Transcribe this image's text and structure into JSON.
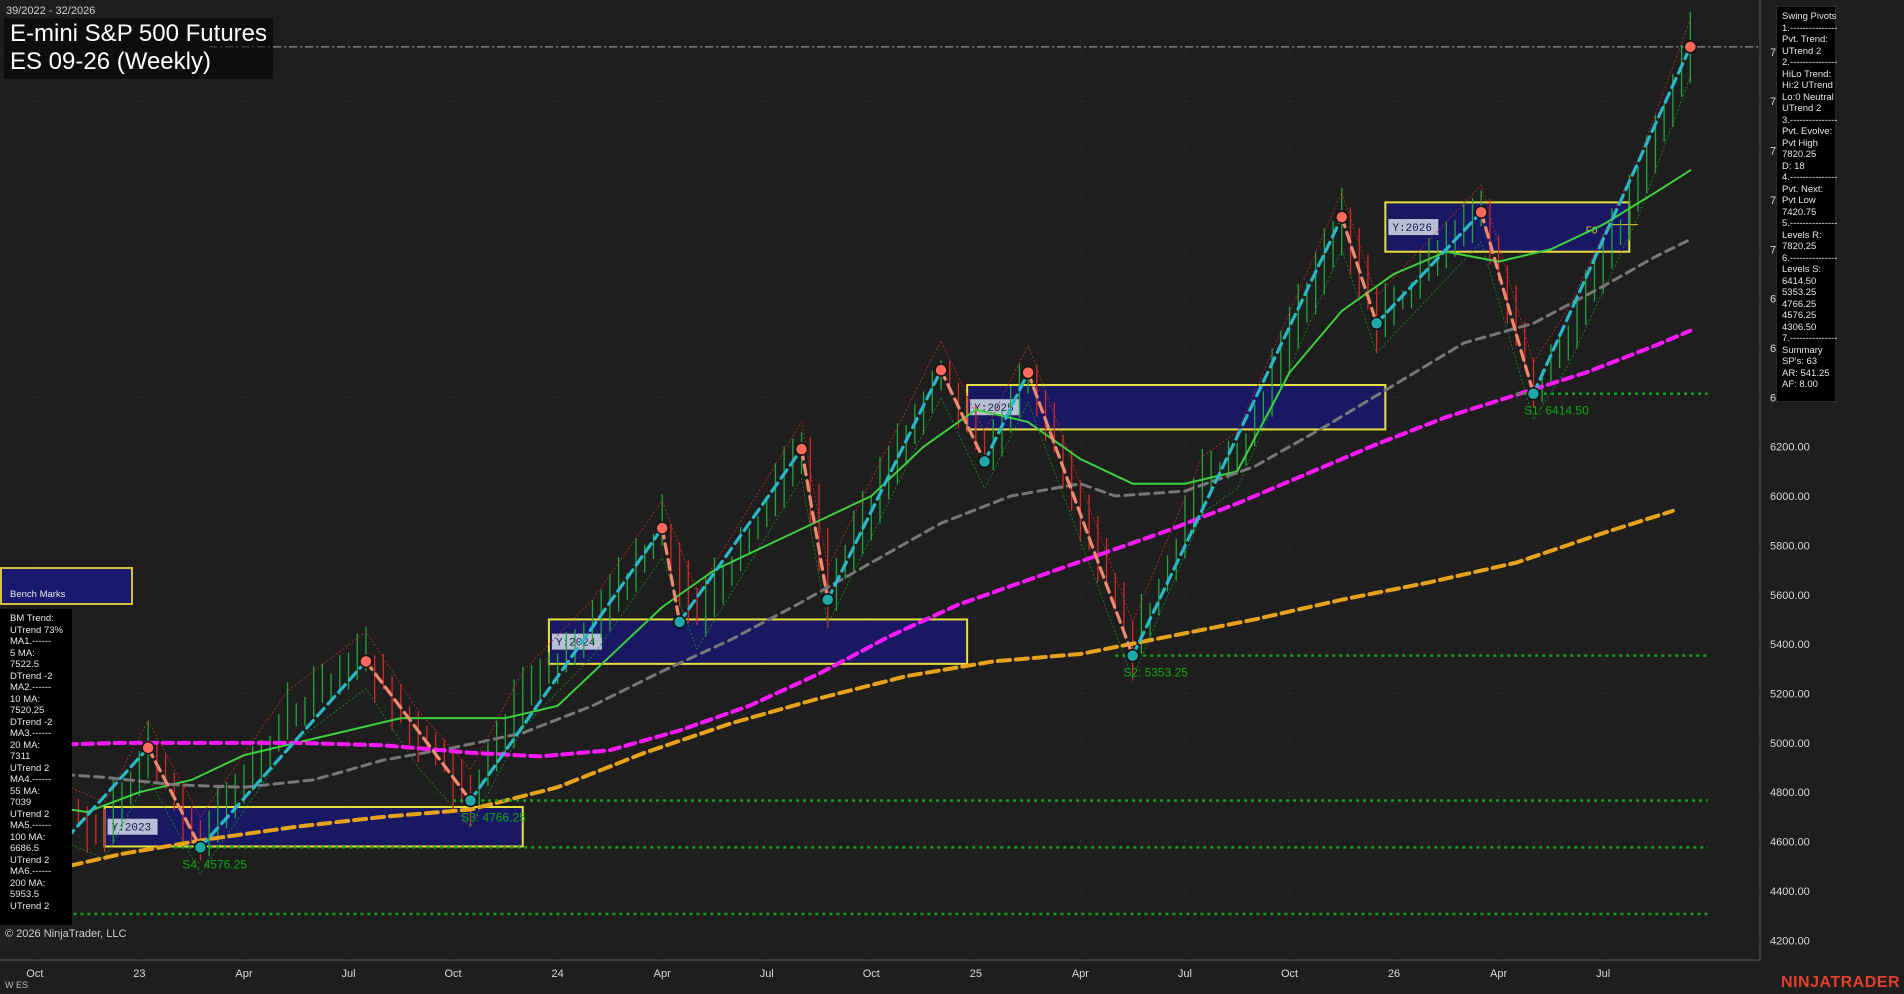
{
  "header": {
    "date_range": "39/2022 - 32/2026",
    "title_line1": "E-mini S&P 500 Futures",
    "title_line2": "ES 09-26 (Weekly)"
  },
  "footer": {
    "copyright": "© 2026 NinjaTrader, LLC",
    "symbol": "W ES",
    "brand": "NINJATRADER"
  },
  "colors": {
    "background": "#1e1e1e",
    "grid": "#3a3a3a",
    "bar_up": "#22a83a",
    "bar_down": "#d42a2a",
    "ma_green": "#3ecf3e",
    "ma_gray": "#777777",
    "ma_magenta": "#ff1aff",
    "ma_orange": "#e6a21a",
    "swing_up": "#2ab8c8",
    "swing_down": "#f08a6e",
    "year_box_fill": "#191970",
    "year_box_border": "#e8e03a",
    "support_line": "#11a611",
    "brand": "#e4402b"
  },
  "swing_pivots_panel": {
    "lines": [
      "Swing Pivots",
      "1.---------------",
      "Pvt. Trend:",
      "UTrend 2",
      "2.---------------",
      "HiLo Trend:",
      "Hi:2 UTrend",
      "Lo:0 Neutral",
      "UTrend 2",
      "3.---------------",
      "Pvt. Evolve:",
      "Pvt High",
      "7820.25",
      "D: 18",
      "4.---------------",
      "Pvt. Next:",
      "Pvt Low",
      "7420.75",
      "5.---------------",
      "Levels R:",
      "7820.25",
      "6.---------------",
      "Levels S:",
      "6414.50",
      "5353.25",
      "4766.25",
      "4576.25",
      "4306.50",
      "7.---------------",
      "Summary",
      "SP's: 63",
      "AR: 541.25",
      "AF: 8.00"
    ]
  },
  "bench_marks_panel": {
    "header": "Bench Marks",
    "lines": [
      "BM Trend:",
      "UTrend 73%",
      "MA1.------",
      "5 MA:",
      "7522.5",
      "DTrend -2",
      "MA2.------",
      "10 MA:",
      "7520.25",
      "DTrend -2",
      "MA3.------",
      "20 MA:",
      "7311",
      "UTrend 2",
      "MA4.------",
      "55 MA:",
      "7039",
      "UTrend 2",
      "MA5.------",
      "100 MA:",
      "6686.5",
      "UTrend 2",
      "MA6.------",
      "200 MA:",
      "5953.5",
      "UTrend 2"
    ]
  },
  "chart_data": {
    "type": "candlestick",
    "y_range": [
      4120,
      8010
    ],
    "x_range": [
      -4,
      198
    ],
    "y_ticks": [
      4200,
      4400,
      4600,
      4800,
      5000,
      5200,
      5400,
      5600,
      5800,
      6000,
      6200,
      6400,
      6600,
      6800,
      7000,
      7200,
      7400,
      7600,
      7800
    ],
    "y_tick_labels": [
      "4200.00",
      "4400.00",
      "4600.00",
      "4800.00",
      "5000.00",
      "5200.00",
      "5400.00",
      "5600.00",
      "5800.00",
      "6000.00",
      "6200.00",
      "6400.00",
      "6600.00",
      "6800.00",
      "7000.00",
      "7200.00",
      "7400.00",
      "7600.00",
      "7800.00"
    ],
    "x_ticks": [
      {
        "x": 0,
        "label": "Oct"
      },
      {
        "x": 12,
        "label": "23"
      },
      {
        "x": 24,
        "label": "Apr"
      },
      {
        "x": 36,
        "label": "Jul"
      },
      {
        "x": 48,
        "label": "Oct"
      },
      {
        "x": 60,
        "label": "24"
      },
      {
        "x": 72,
        "label": "Apr"
      },
      {
        "x": 84,
        "label": "Jul"
      },
      {
        "x": 96,
        "label": "Oct"
      },
      {
        "x": 108,
        "label": "25"
      },
      {
        "x": 120,
        "label": "Apr"
      },
      {
        "x": 132,
        "label": "Jul"
      },
      {
        "x": 144,
        "label": "Oct"
      },
      {
        "x": 156,
        "label": "26"
      },
      {
        "x": 168,
        "label": "Apr"
      },
      {
        "x": 180,
        "label": "Jul"
      }
    ],
    "price_anchors": [
      [
        0,
        4600
      ],
      [
        4,
        4710
      ],
      [
        8,
        4650
      ],
      [
        13,
        4980
      ],
      [
        19,
        4590
      ],
      [
        29,
        5100
      ],
      [
        38,
        5340
      ],
      [
        44,
        5020
      ],
      [
        50,
        4780
      ],
      [
        56,
        5180
      ],
      [
        64,
        5470
      ],
      [
        72,
        5870
      ],
      [
        76,
        5500
      ],
      [
        88,
        6190
      ],
      [
        91,
        5600
      ],
      [
        104,
        6520
      ],
      [
        109,
        6150
      ],
      [
        114,
        6500
      ],
      [
        126,
        5380
      ],
      [
        134,
        6050
      ],
      [
        138,
        6150
      ],
      [
        150,
        7120
      ],
      [
        154,
        6700
      ],
      [
        166,
        7150
      ],
      [
        172,
        6430
      ],
      [
        176,
        6650
      ],
      [
        184,
        7250
      ],
      [
        190,
        7820
      ],
      [
        190.5,
        7750
      ]
    ],
    "swing_points": [
      {
        "x": 0,
        "y": 4470,
        "type": "low"
      },
      {
        "x": 13,
        "y": 4980,
        "type": "high"
      },
      {
        "x": 19,
        "y": 4576.25,
        "type": "low"
      },
      {
        "x": 38,
        "y": 5330,
        "type": "high"
      },
      {
        "x": 50,
        "y": 4766.25,
        "type": "low"
      },
      {
        "x": 72,
        "y": 5870,
        "type": "high"
      },
      {
        "x": 74,
        "y": 5490,
        "type": "low"
      },
      {
        "x": 88,
        "y": 6190,
        "type": "high"
      },
      {
        "x": 91,
        "y": 5580,
        "type": "low"
      },
      {
        "x": 104,
        "y": 6510,
        "type": "high"
      },
      {
        "x": 109,
        "y": 6140,
        "type": "low"
      },
      {
        "x": 114,
        "y": 6500,
        "type": "high"
      },
      {
        "x": 126,
        "y": 5353.25,
        "type": "low"
      },
      {
        "x": 150,
        "y": 7130,
        "type": "high"
      },
      {
        "x": 154,
        "y": 6700,
        "type": "low"
      },
      {
        "x": 166,
        "y": 7150,
        "type": "high"
      },
      {
        "x": 172,
        "y": 6414.5,
        "type": "low"
      },
      {
        "x": 190,
        "y": 7820.25,
        "type": "high"
      }
    ],
    "support_levels": [
      {
        "x_start": 170,
        "x_end": 192,
        "value": 6414.5,
        "label": "S1: 6414.50"
      },
      {
        "x_start": 124,
        "x_end": 192,
        "value": 5353.25,
        "label": "S2: 5353.25"
      },
      {
        "x_start": 48,
        "x_end": 192,
        "value": 4766.25,
        "label": "S3: 4766.25"
      },
      {
        "x_start": 16,
        "x_end": 192,
        "value": 4576.25,
        "label": "S4: 4576.25"
      },
      {
        "x_start": -2,
        "x_end": 192,
        "value": 4306.5,
        "label": ""
      }
    ],
    "resistance_level": {
      "value": 7820.25
    },
    "year_boxes": [
      {
        "label": "Y:2023",
        "x0": 8,
        "x1": 56,
        "y0": 4580,
        "y1": 4740
      },
      {
        "label": "Y:2024",
        "x0": 59,
        "x1": 107,
        "y0": 5320,
        "y1": 5500
      },
      {
        "label": "Y:2025",
        "x0": 107,
        "x1": 155,
        "y0": 6270,
        "y1": 6450
      },
      {
        "label": "Y:2026",
        "x0": 155,
        "x1": 183,
        "y0": 6990,
        "y1": 7190
      }
    ],
    "f0_label": {
      "text": "F0",
      "x": 178,
      "value": 7080
    },
    "moving_averages": [
      {
        "name": "5 MA",
        "color": "#3ecf3e",
        "width": 2,
        "dash": "",
        "points": [
          [
            0,
            4750
          ],
          [
            6,
            4720
          ],
          [
            12,
            4800
          ],
          [
            18,
            4850
          ],
          [
            24,
            4950
          ],
          [
            30,
            5000
          ],
          [
            36,
            5050
          ],
          [
            42,
            5100
          ],
          [
            48,
            5100
          ],
          [
            54,
            5100
          ],
          [
            60,
            5150
          ],
          [
            66,
            5350
          ],
          [
            72,
            5550
          ],
          [
            78,
            5700
          ],
          [
            84,
            5800
          ],
          [
            90,
            5900
          ],
          [
            96,
            6000
          ],
          [
            102,
            6200
          ],
          [
            108,
            6350
          ],
          [
            114,
            6300
          ],
          [
            120,
            6150
          ],
          [
            126,
            6050
          ],
          [
            132,
            6050
          ],
          [
            138,
            6100
          ],
          [
            144,
            6500
          ],
          [
            150,
            6750
          ],
          [
            156,
            6900
          ],
          [
            162,
            6990
          ],
          [
            168,
            6950
          ],
          [
            174,
            7000
          ],
          [
            180,
            7100
          ],
          [
            186,
            7230
          ],
          [
            190,
            7320
          ]
        ]
      },
      {
        "name": "55 MA",
        "color": "#777777",
        "width": 3,
        "dash": "9,6",
        "points": [
          [
            0,
            4880
          ],
          [
            8,
            4860
          ],
          [
            16,
            4830
          ],
          [
            24,
            4820
          ],
          [
            32,
            4850
          ],
          [
            40,
            4930
          ],
          [
            48,
            4980
          ],
          [
            56,
            5040
          ],
          [
            64,
            5150
          ],
          [
            72,
            5290
          ],
          [
            80,
            5420
          ],
          [
            88,
            5570
          ],
          [
            96,
            5730
          ],
          [
            104,
            5890
          ],
          [
            112,
            6000
          ],
          [
            120,
            6050
          ],
          [
            124,
            6000
          ],
          [
            132,
            6020
          ],
          [
            140,
            6120
          ],
          [
            148,
            6280
          ],
          [
            156,
            6450
          ],
          [
            164,
            6620
          ],
          [
            172,
            6700
          ],
          [
            180,
            6850
          ],
          [
            186,
            6970
          ],
          [
            190,
            7040
          ]
        ]
      },
      {
        "name": "100 MA",
        "color": "#ff1aff",
        "width": 4,
        "dash": "10,6",
        "points": [
          [
            0,
            4990
          ],
          [
            10,
            5000
          ],
          [
            20,
            5000
          ],
          [
            30,
            5000
          ],
          [
            40,
            4990
          ],
          [
            50,
            4960
          ],
          [
            58,
            4945
          ],
          [
            66,
            4970
          ],
          [
            74,
            5050
          ],
          [
            82,
            5150
          ],
          [
            90,
            5280
          ],
          [
            98,
            5430
          ],
          [
            106,
            5560
          ],
          [
            114,
            5660
          ],
          [
            122,
            5760
          ],
          [
            130,
            5860
          ],
          [
            138,
            5970
          ],
          [
            146,
            6090
          ],
          [
            154,
            6210
          ],
          [
            162,
            6320
          ],
          [
            170,
            6410
          ],
          [
            178,
            6500
          ],
          [
            186,
            6610
          ],
          [
            190,
            6670
          ]
        ]
      },
      {
        "name": "200 MA",
        "color": "#e6a21a",
        "width": 4,
        "dash": "12,6",
        "points": [
          [
            0,
            4470
          ],
          [
            10,
            4550
          ],
          [
            20,
            4610
          ],
          [
            30,
            4660
          ],
          [
            40,
            4700
          ],
          [
            50,
            4730
          ],
          [
            60,
            4820
          ],
          [
            70,
            4960
          ],
          [
            80,
            5080
          ],
          [
            90,
            5180
          ],
          [
            100,
            5270
          ],
          [
            110,
            5330
          ],
          [
            120,
            5360
          ],
          [
            130,
            5430
          ],
          [
            140,
            5500
          ],
          [
            150,
            5580
          ],
          [
            160,
            5650
          ],
          [
            170,
            5730
          ],
          [
            180,
            5850
          ],
          [
            188,
            5940
          ]
        ]
      }
    ]
  }
}
